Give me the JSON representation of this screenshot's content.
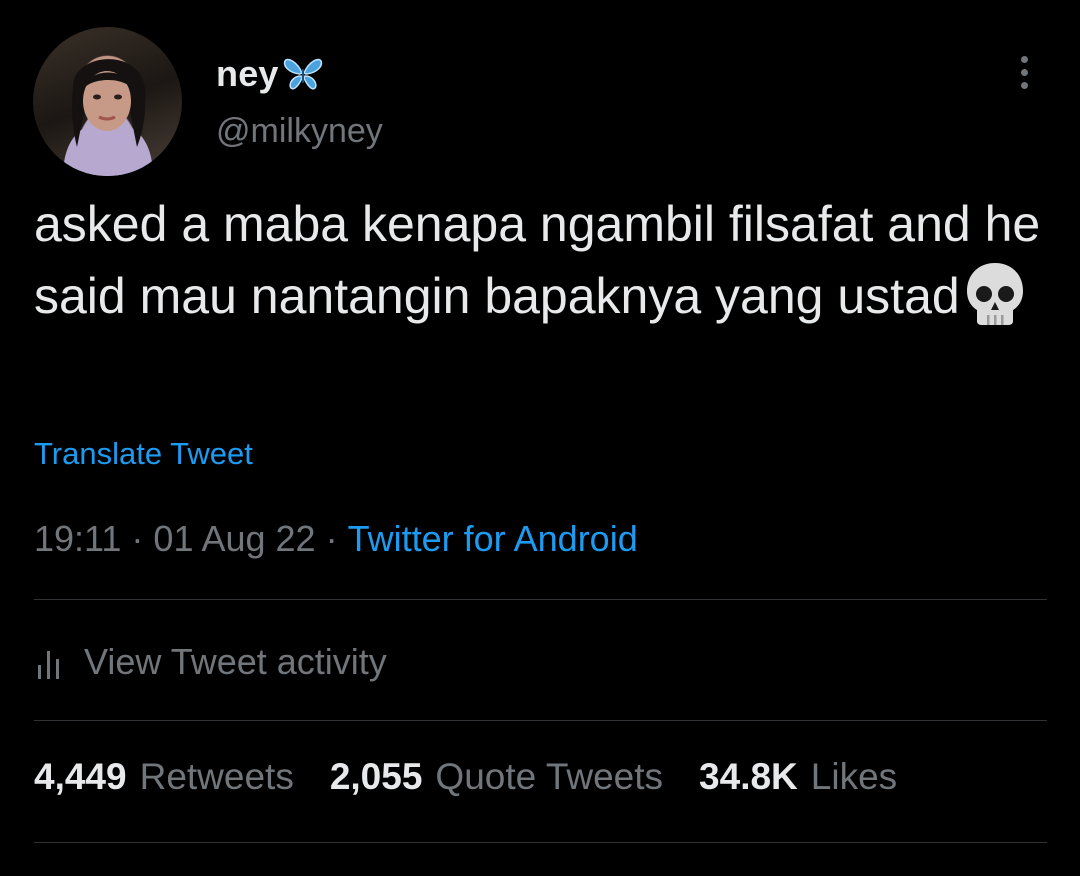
{
  "user": {
    "display_name": "ney",
    "handle": "@milkyney",
    "name_emoji": "butterfly-icon"
  },
  "tweet": {
    "text": "asked a maba kenapa ngambil filsafat and he said mau nantangin bapaknya yang ustad",
    "emoji": "skull-icon",
    "translate_label": "Translate Tweet",
    "time": "19:11",
    "date": "01 Aug 22",
    "separator": "·",
    "source": "Twitter for Android"
  },
  "activity": {
    "label": "View Tweet activity",
    "icon": "bar-chart-icon"
  },
  "stats": {
    "retweets": {
      "count": "4,449",
      "label": "Retweets"
    },
    "quotes": {
      "count": "2,055",
      "label": "Quote Tweets"
    },
    "likes": {
      "count": "34.8K",
      "label": "Likes"
    }
  },
  "colors": {
    "background": "#000000",
    "primary_text": "#e7e9ea",
    "secondary_text": "#71767b",
    "accent": "#1d9bf0",
    "divider": "#2f3336"
  }
}
